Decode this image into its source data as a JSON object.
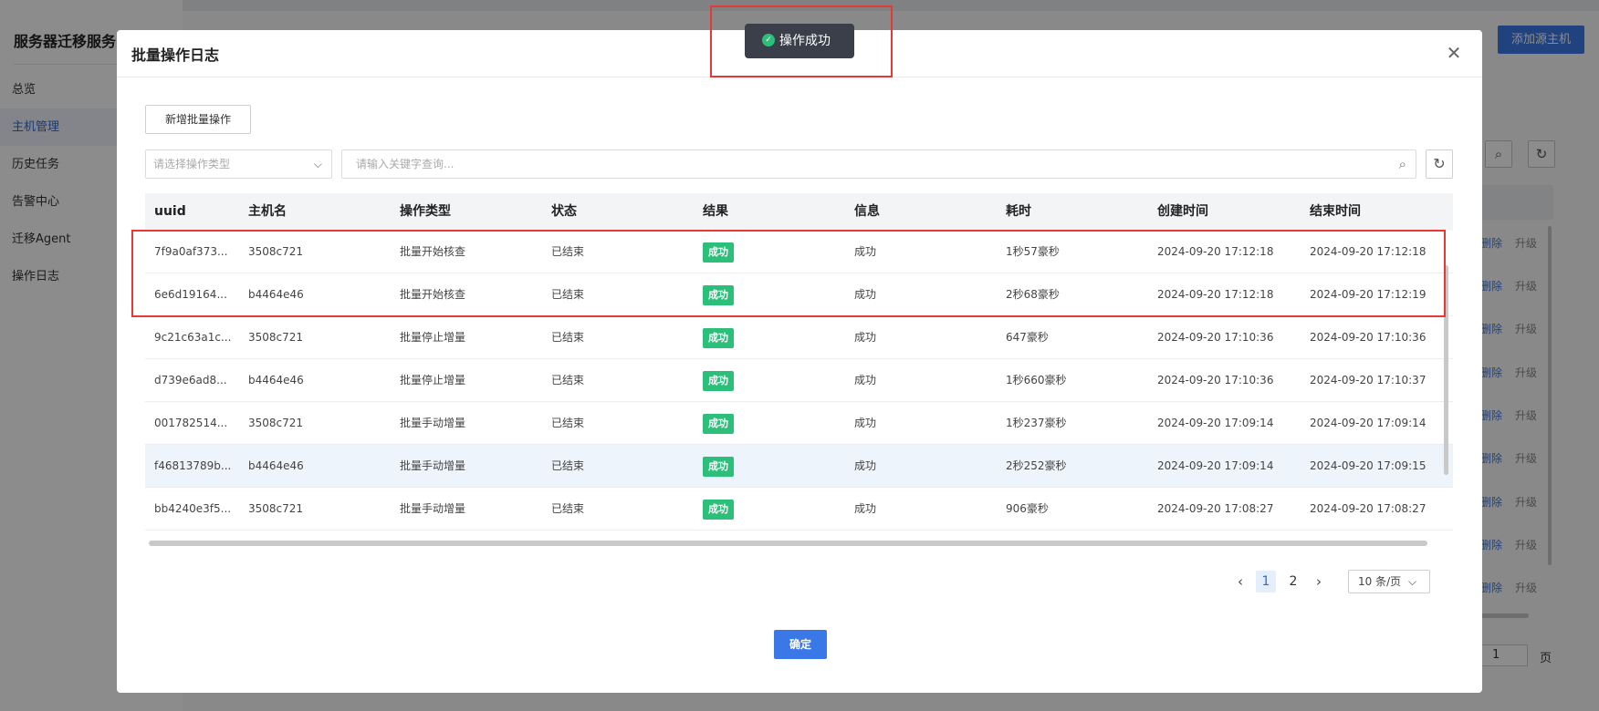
{
  "sidebar": {
    "title": "服务器迁移服务",
    "items": [
      {
        "label": "总览"
      },
      {
        "label": "主机管理"
      },
      {
        "label": "历史任务"
      },
      {
        "label": "告警中心"
      },
      {
        "label": "迁移Agent"
      },
      {
        "label": "操作日志"
      }
    ],
    "active_index": 1
  },
  "background": {
    "add_source_button": "添加源主机",
    "row_actions": {
      "delete": "删除",
      "upgrade": "升级"
    },
    "page_input_value": "1",
    "page_label": "页"
  },
  "toast": {
    "message": "操作成功"
  },
  "modal": {
    "title": "批量操作日志",
    "add_button": "新增批量操作",
    "type_select_placeholder": "请选择操作类型",
    "search_placeholder": "请输入关键字查询...",
    "confirm_button": "确定",
    "table": {
      "columns": [
        "uuid",
        "主机名",
        "操作类型",
        "状态",
        "结果",
        "信息",
        "耗时",
        "创建时间",
        "结束时间"
      ],
      "rows": [
        {
          "uuid": "7f9a0af373...",
          "host": "3508c721",
          "type": "批量开始核查",
          "status": "已结束",
          "result": "成功",
          "info": "成功",
          "duration": "1秒57豪秒",
          "created": "2024-09-20 17:12:18",
          "ended": "2024-09-20 17:12:18"
        },
        {
          "uuid": "6e6d19164...",
          "host": "b4464e46",
          "type": "批量开始核查",
          "status": "已结束",
          "result": "成功",
          "info": "成功",
          "duration": "2秒68豪秒",
          "created": "2024-09-20 17:12:18",
          "ended": "2024-09-20 17:12:19"
        },
        {
          "uuid": "9c21c63a1c...",
          "host": "3508c721",
          "type": "批量停止增量",
          "status": "已结束",
          "result": "成功",
          "info": "成功",
          "duration": "647豪秒",
          "created": "2024-09-20 17:10:36",
          "ended": "2024-09-20 17:10:36"
        },
        {
          "uuid": "d739e6ad8...",
          "host": "b4464e46",
          "type": "批量停止增量",
          "status": "已结束",
          "result": "成功",
          "info": "成功",
          "duration": "1秒660豪秒",
          "created": "2024-09-20 17:10:36",
          "ended": "2024-09-20 17:10:37"
        },
        {
          "uuid": "001782514...",
          "host": "3508c721",
          "type": "批量手动增量",
          "status": "已结束",
          "result": "成功",
          "info": "成功",
          "duration": "1秒237豪秒",
          "created": "2024-09-20 17:09:14",
          "ended": "2024-09-20 17:09:14"
        },
        {
          "uuid": "f46813789b...",
          "host": "b4464e46",
          "type": "批量手动增量",
          "status": "已结束",
          "result": "成功",
          "info": "成功",
          "duration": "2秒252豪秒",
          "created": "2024-09-20 17:09:14",
          "ended": "2024-09-20 17:09:15"
        },
        {
          "uuid": "bb4240e3f5...",
          "host": "3508c721",
          "type": "批量手动增量",
          "status": "已结束",
          "result": "成功",
          "info": "成功",
          "duration": "906豪秒",
          "created": "2024-09-20 17:08:27",
          "ended": "2024-09-20 17:08:27"
        }
      ]
    },
    "pagination": {
      "pages": [
        "1",
        "2"
      ],
      "current": "1",
      "page_size": "10 条/页"
    }
  },
  "colors": {
    "primary": "#3b78e7",
    "success": "#2bbf7a",
    "highlight": "#e53935"
  }
}
